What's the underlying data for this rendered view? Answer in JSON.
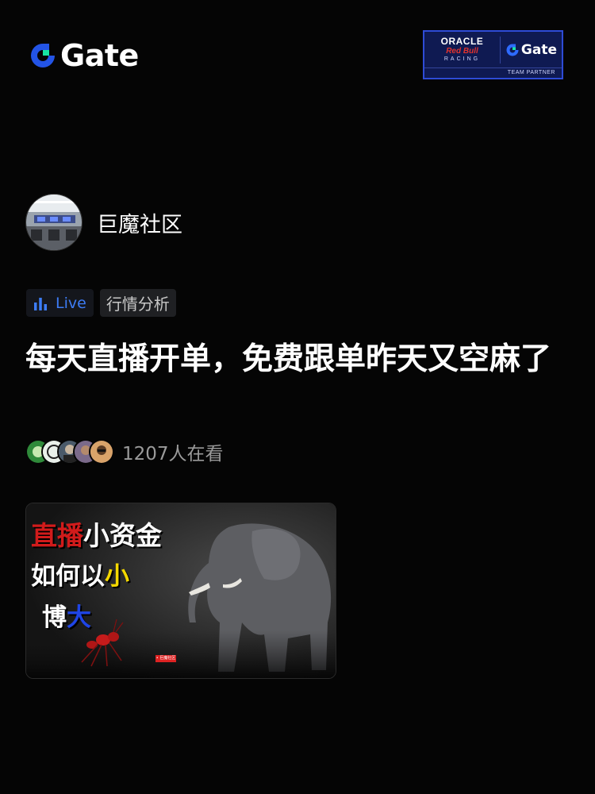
{
  "header": {
    "logo_text": "Gate",
    "partner": {
      "oracle": "ORACLE",
      "redbull": "Red Bull",
      "racing": "RACING",
      "gate": "Gate",
      "footer": "TEAM PARTNER"
    }
  },
  "author": {
    "name": "巨魔社区"
  },
  "tags": {
    "live": "Live",
    "category": "行情分析"
  },
  "post": {
    "title": "每天直播开单，免费跟单昨天又空麻了"
  },
  "viewers": {
    "count_text": "1207人在看"
  },
  "thumbnail": {
    "line1_red": "直播",
    "line1_white": "小资金",
    "line2_white": "如何以",
    "line2_yellow": "小",
    "line3_white": "博",
    "line3_blue": "大",
    "badge": "• 巨魔社区"
  },
  "colors": {
    "background": "#050505",
    "gate_green": "#17e5a4",
    "gate_blue": "#2354e6",
    "live_blue": "#3d7cf5",
    "muted_text": "#9a9a9a"
  }
}
